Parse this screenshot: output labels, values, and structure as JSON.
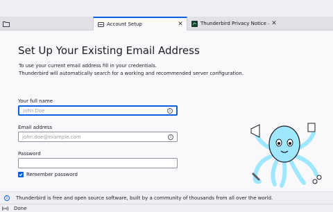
{
  "tabs": [
    {
      "label": "Account Setup",
      "icon": "account-setup-icon",
      "active": true
    },
    {
      "label": "Thunderbird Privacy Notice — M",
      "icon": "privacy-page-icon",
      "active": false
    }
  ],
  "main": {
    "heading": "Set Up Your Existing Email Address",
    "intro_line1": "To use your current email address fill in your credentials.",
    "intro_line2": "Thunderbird will automatically search for a working and recommended server configuration.",
    "fullname": {
      "label": "Your full name",
      "placeholder": "John Doe",
      "value": ""
    },
    "email": {
      "label": "Email address",
      "placeholder": "john.doe@example.com",
      "value": ""
    },
    "password": {
      "label": "Password",
      "value": ""
    },
    "remember_password": {
      "label": "Remember password",
      "checked": true
    }
  },
  "footer": {
    "text": "Thunderbird is free and open source software, built by a community of thousands from all over the world."
  },
  "status": {
    "text": "Done"
  },
  "colors": {
    "accent": "#0060df",
    "background": "#f9f9fb",
    "tabbar": "#e0e0e6",
    "mascot": "#9fe6ff"
  }
}
